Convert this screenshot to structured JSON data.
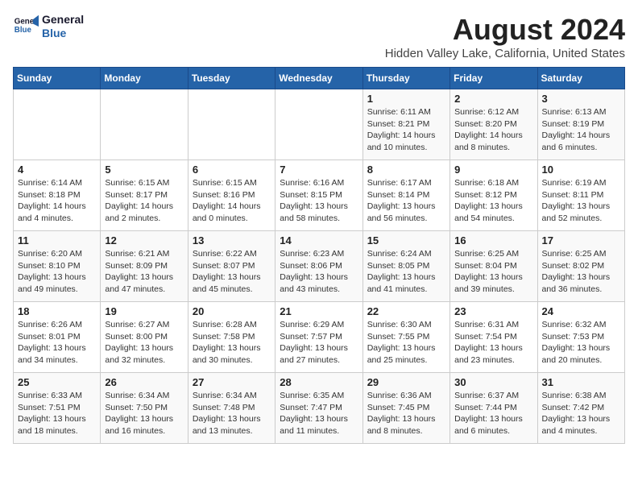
{
  "header": {
    "logo_line1": "General",
    "logo_line2": "Blue",
    "month_year": "August 2024",
    "location": "Hidden Valley Lake, California, United States"
  },
  "days_of_week": [
    "Sunday",
    "Monday",
    "Tuesday",
    "Wednesday",
    "Thursday",
    "Friday",
    "Saturday"
  ],
  "weeks": [
    [
      {
        "day": "",
        "info": ""
      },
      {
        "day": "",
        "info": ""
      },
      {
        "day": "",
        "info": ""
      },
      {
        "day": "",
        "info": ""
      },
      {
        "day": "1",
        "info": "Sunrise: 6:11 AM\nSunset: 8:21 PM\nDaylight: 14 hours\nand 10 minutes."
      },
      {
        "day": "2",
        "info": "Sunrise: 6:12 AM\nSunset: 8:20 PM\nDaylight: 14 hours\nand 8 minutes."
      },
      {
        "day": "3",
        "info": "Sunrise: 6:13 AM\nSunset: 8:19 PM\nDaylight: 14 hours\nand 6 minutes."
      }
    ],
    [
      {
        "day": "4",
        "info": "Sunrise: 6:14 AM\nSunset: 8:18 PM\nDaylight: 14 hours\nand 4 minutes."
      },
      {
        "day": "5",
        "info": "Sunrise: 6:15 AM\nSunset: 8:17 PM\nDaylight: 14 hours\nand 2 minutes."
      },
      {
        "day": "6",
        "info": "Sunrise: 6:15 AM\nSunset: 8:16 PM\nDaylight: 14 hours\nand 0 minutes."
      },
      {
        "day": "7",
        "info": "Sunrise: 6:16 AM\nSunset: 8:15 PM\nDaylight: 13 hours\nand 58 minutes."
      },
      {
        "day": "8",
        "info": "Sunrise: 6:17 AM\nSunset: 8:14 PM\nDaylight: 13 hours\nand 56 minutes."
      },
      {
        "day": "9",
        "info": "Sunrise: 6:18 AM\nSunset: 8:12 PM\nDaylight: 13 hours\nand 54 minutes."
      },
      {
        "day": "10",
        "info": "Sunrise: 6:19 AM\nSunset: 8:11 PM\nDaylight: 13 hours\nand 52 minutes."
      }
    ],
    [
      {
        "day": "11",
        "info": "Sunrise: 6:20 AM\nSunset: 8:10 PM\nDaylight: 13 hours\nand 49 minutes."
      },
      {
        "day": "12",
        "info": "Sunrise: 6:21 AM\nSunset: 8:09 PM\nDaylight: 13 hours\nand 47 minutes."
      },
      {
        "day": "13",
        "info": "Sunrise: 6:22 AM\nSunset: 8:07 PM\nDaylight: 13 hours\nand 45 minutes."
      },
      {
        "day": "14",
        "info": "Sunrise: 6:23 AM\nSunset: 8:06 PM\nDaylight: 13 hours\nand 43 minutes."
      },
      {
        "day": "15",
        "info": "Sunrise: 6:24 AM\nSunset: 8:05 PM\nDaylight: 13 hours\nand 41 minutes."
      },
      {
        "day": "16",
        "info": "Sunrise: 6:25 AM\nSunset: 8:04 PM\nDaylight: 13 hours\nand 39 minutes."
      },
      {
        "day": "17",
        "info": "Sunrise: 6:25 AM\nSunset: 8:02 PM\nDaylight: 13 hours\nand 36 minutes."
      }
    ],
    [
      {
        "day": "18",
        "info": "Sunrise: 6:26 AM\nSunset: 8:01 PM\nDaylight: 13 hours\nand 34 minutes."
      },
      {
        "day": "19",
        "info": "Sunrise: 6:27 AM\nSunset: 8:00 PM\nDaylight: 13 hours\nand 32 minutes."
      },
      {
        "day": "20",
        "info": "Sunrise: 6:28 AM\nSunset: 7:58 PM\nDaylight: 13 hours\nand 30 minutes."
      },
      {
        "day": "21",
        "info": "Sunrise: 6:29 AM\nSunset: 7:57 PM\nDaylight: 13 hours\nand 27 minutes."
      },
      {
        "day": "22",
        "info": "Sunrise: 6:30 AM\nSunset: 7:55 PM\nDaylight: 13 hours\nand 25 minutes."
      },
      {
        "day": "23",
        "info": "Sunrise: 6:31 AM\nSunset: 7:54 PM\nDaylight: 13 hours\nand 23 minutes."
      },
      {
        "day": "24",
        "info": "Sunrise: 6:32 AM\nSunset: 7:53 PM\nDaylight: 13 hours\nand 20 minutes."
      }
    ],
    [
      {
        "day": "25",
        "info": "Sunrise: 6:33 AM\nSunset: 7:51 PM\nDaylight: 13 hours\nand 18 minutes."
      },
      {
        "day": "26",
        "info": "Sunrise: 6:34 AM\nSunset: 7:50 PM\nDaylight: 13 hours\nand 16 minutes."
      },
      {
        "day": "27",
        "info": "Sunrise: 6:34 AM\nSunset: 7:48 PM\nDaylight: 13 hours\nand 13 minutes."
      },
      {
        "day": "28",
        "info": "Sunrise: 6:35 AM\nSunset: 7:47 PM\nDaylight: 13 hours\nand 11 minutes."
      },
      {
        "day": "29",
        "info": "Sunrise: 6:36 AM\nSunset: 7:45 PM\nDaylight: 13 hours\nand 8 minutes."
      },
      {
        "day": "30",
        "info": "Sunrise: 6:37 AM\nSunset: 7:44 PM\nDaylight: 13 hours\nand 6 minutes."
      },
      {
        "day": "31",
        "info": "Sunrise: 6:38 AM\nSunset: 7:42 PM\nDaylight: 13 hours\nand 4 minutes."
      }
    ]
  ]
}
